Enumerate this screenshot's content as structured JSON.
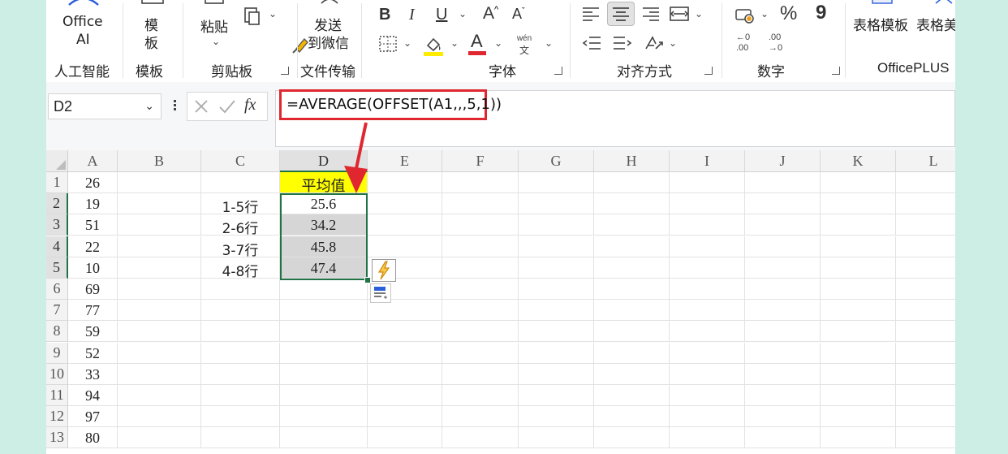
{
  "ribbon": {
    "groups": [
      {
        "id": "ai",
        "label": "人工智能",
        "buttons": [
          {
            "line1": "Office",
            "line2": "AI"
          }
        ]
      },
      {
        "id": "template",
        "label": "模板",
        "buttons": [
          {
            "line1": "模",
            "line2": "板"
          }
        ]
      },
      {
        "id": "clipboard",
        "label": "剪贴板",
        "buttons": [
          {
            "line1": "粘贴"
          }
        ]
      },
      {
        "id": "transfer",
        "label": "文件传输",
        "buttons": [
          {
            "line1": "发送",
            "line2": "到微信"
          }
        ]
      },
      {
        "id": "font",
        "label": "字体"
      },
      {
        "id": "align",
        "label": "对齐方式"
      },
      {
        "id": "number",
        "label": "数字"
      },
      {
        "id": "officeplus",
        "label": "OfficePLUS",
        "buttons": [
          {
            "line1": "表格模板"
          },
          {
            "line1": "表格美"
          }
        ]
      }
    ],
    "font_glyphs": {
      "bold": "B",
      "italic": "I",
      "underline": "U",
      "grow": "A",
      "shrink": "A",
      "font_color": "A",
      "phonetic_top": "wén",
      "phonetic_bottom": "文"
    },
    "number_glyphs": {
      "percent": "%",
      "comma": "9",
      "inc_top": "←0",
      "inc_bottom": ".00",
      "dec_top": ".00",
      "dec_bottom": "→0"
    },
    "colors": {
      "highlight": "#ffeb00",
      "font_color": "#e0272f"
    }
  },
  "formula_bar": {
    "name_box": "D2",
    "fx": "fx",
    "formula": "=AVERAGE(OFFSET(A1,,,5,1))"
  },
  "grid": {
    "columns": [
      "A",
      "B",
      "C",
      "D",
      "E",
      "F",
      "G",
      "H",
      "I",
      "J",
      "K",
      "L"
    ],
    "rows": [
      "1",
      "2",
      "3",
      "4",
      "5",
      "6",
      "7",
      "8",
      "9",
      "10",
      "11",
      "12",
      "13"
    ],
    "active_column": "D",
    "active_rows": [
      "2",
      "3",
      "4",
      "5"
    ],
    "column_a": [
      "26",
      "19",
      "51",
      "22",
      "10",
      "69",
      "77",
      "59",
      "52",
      "33",
      "94",
      "97",
      "80"
    ],
    "column_c": [
      "",
      "1-5行",
      "2-6行",
      "3-7行",
      "4-8行"
    ],
    "column_d": [
      "平均值",
      "25.6",
      "34.2",
      "45.8",
      "47.4"
    ]
  },
  "colors": {
    "selection": "#217346",
    "header_fill": "#ffff00",
    "annotation": "#e0272f",
    "quick_analysis": "#f0a020"
  }
}
